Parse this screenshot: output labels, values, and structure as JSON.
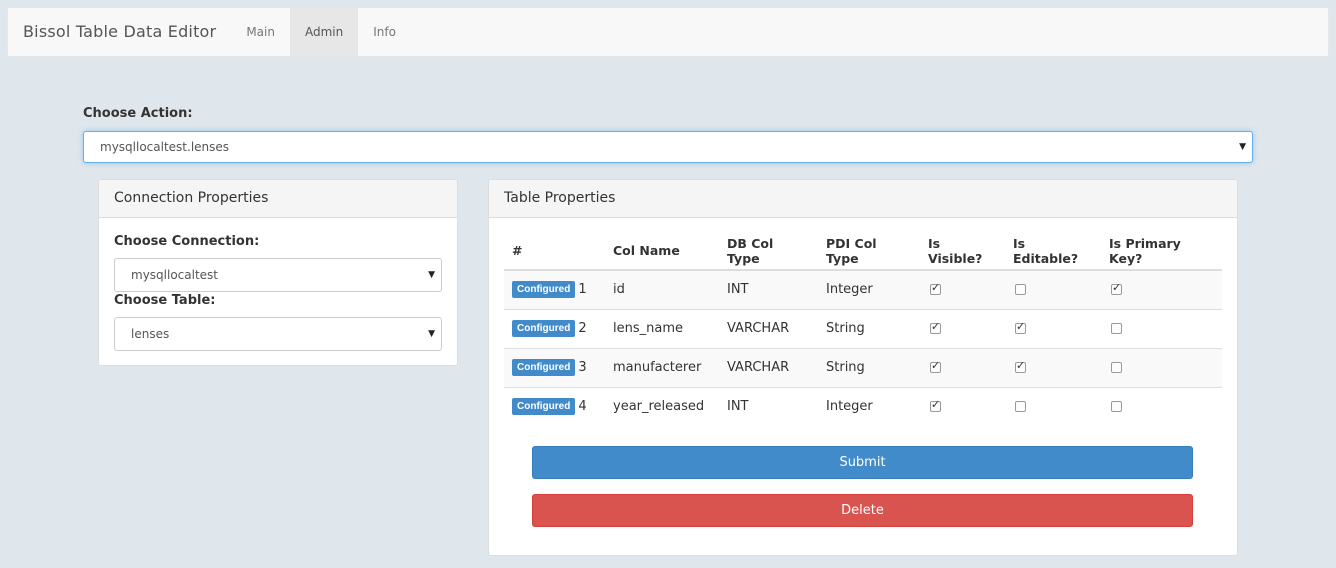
{
  "navbar": {
    "brand": "Bissol Table Data Editor",
    "items": [
      {
        "label": "Main",
        "active": false
      },
      {
        "label": "Admin",
        "active": true
      },
      {
        "label": "Info",
        "active": false
      }
    ]
  },
  "action": {
    "label": "Choose Action:",
    "selected": "mysqllocaltest.lenses"
  },
  "connection_panel": {
    "title": "Connection Properties",
    "connection_label": "Choose Connection:",
    "connection_selected": "mysqllocaltest",
    "table_label": "Choose Table:",
    "table_selected": "lenses"
  },
  "table_panel": {
    "title": "Table Properties",
    "headers": [
      "#",
      "Col Name",
      "DB Col Type",
      "PDI Col Type",
      "Is Visible?",
      "Is Editable?",
      "Is Primary Key?"
    ],
    "badge_label": "Configured",
    "rows": [
      {
        "num": "1",
        "col_name": "id",
        "db_type": "INT",
        "pdi_type": "Integer",
        "visible": true,
        "editable": false,
        "primary": true
      },
      {
        "num": "2",
        "col_name": "lens_name",
        "db_type": "VARCHAR",
        "pdi_type": "String",
        "visible": true,
        "editable": true,
        "primary": false
      },
      {
        "num": "3",
        "col_name": "manufacterer",
        "db_type": "VARCHAR",
        "pdi_type": "String",
        "visible": true,
        "editable": true,
        "primary": false
      },
      {
        "num": "4",
        "col_name": "year_released",
        "db_type": "INT",
        "pdi_type": "Integer",
        "visible": true,
        "editable": false,
        "primary": false
      }
    ],
    "submit_label": "Submit",
    "delete_label": "Delete"
  },
  "colors": {
    "primary": "#428bca",
    "danger": "#d9534f",
    "background": "#e0e7ec"
  }
}
